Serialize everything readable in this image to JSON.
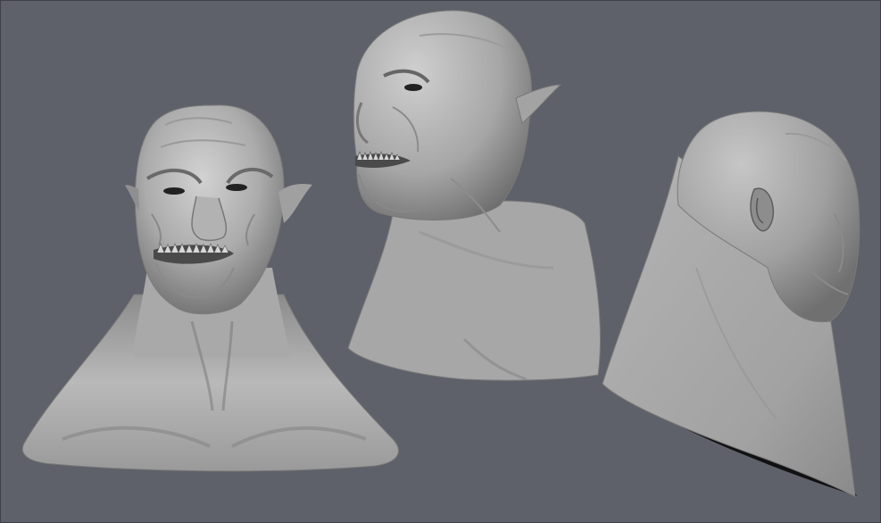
{
  "scene": {
    "background_color": "#5e6169",
    "material_light": "#c9c9c9",
    "material_mid": "#a4a4a4",
    "material_dark": "#5a5a5a",
    "shadow_color": "#0d0d0f",
    "sculpts": [
      {
        "view": "front",
        "icon": "sculpt-bust-front"
      },
      {
        "view": "three-quarter",
        "icon": "sculpt-bust-three-quarter"
      },
      {
        "view": "back",
        "icon": "sculpt-bust-back"
      }
    ]
  }
}
